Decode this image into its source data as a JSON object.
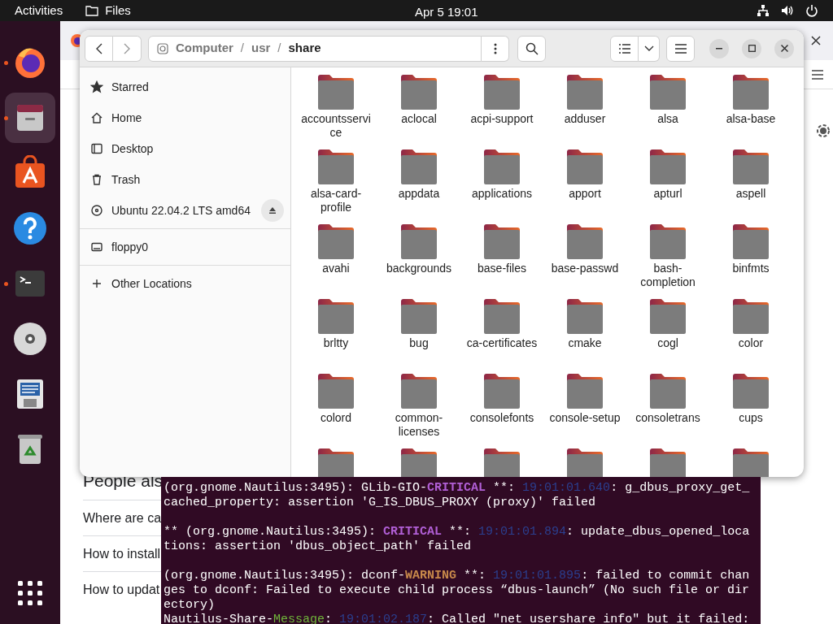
{
  "top_bar": {
    "activities": "Activities",
    "app_menu": "Files",
    "clock": "Apr 5  19:01"
  },
  "dock": [
    {
      "kind": "firefox",
      "running": true,
      "selected": false
    },
    {
      "kind": "files",
      "running": true,
      "selected": true
    },
    {
      "kind": "appcenter",
      "running": false,
      "selected": false
    },
    {
      "kind": "help",
      "running": false,
      "selected": false
    },
    {
      "kind": "terminal",
      "running": true,
      "selected": false
    },
    {
      "kind": "disc",
      "running": false,
      "selected": false
    },
    {
      "kind": "floppy",
      "running": false,
      "selected": false
    },
    {
      "kind": "trash",
      "running": false,
      "selected": false
    }
  ],
  "browser": {
    "heading": "People als",
    "links": [
      "Where are ca",
      "How to install",
      "How to updat"
    ]
  },
  "files_window": {
    "path": [
      {
        "kind": "segment",
        "text": "Computer",
        "selected": false
      },
      {
        "kind": "separator",
        "text": "/"
      },
      {
        "kind": "segment",
        "text": "usr",
        "selected": false
      },
      {
        "kind": "separator",
        "text": "/"
      },
      {
        "kind": "segment",
        "text": "share",
        "selected": true
      }
    ],
    "sidebar": [
      {
        "kind": "starred",
        "label": "Starred"
      },
      {
        "kind": "home",
        "label": "Home"
      },
      {
        "kind": "desktop",
        "label": "Desktop"
      },
      {
        "kind": "trash",
        "label": "Trash"
      },
      {
        "kind": "drive",
        "label": "Ubuntu 22.04.2 LTS amd64",
        "ejectable": true
      },
      {
        "kind": "floppy",
        "label": "floppy0",
        "ejectable": false
      },
      {
        "kind": "other",
        "label": "Other Locations"
      }
    ],
    "folders": [
      {
        "kind": "folder",
        "name": "accountsservice"
      },
      {
        "kind": "folder",
        "name": "aclocal"
      },
      {
        "kind": "folder",
        "name": "acpi-support"
      },
      {
        "kind": "folder",
        "name": "adduser"
      },
      {
        "kind": "folder",
        "name": "alsa"
      },
      {
        "kind": "folder",
        "name": "alsa-base"
      },
      {
        "kind": "folder",
        "name": "alsa-card-profile"
      },
      {
        "kind": "folder",
        "name": "appdata"
      },
      {
        "kind": "folder",
        "name": "applications"
      },
      {
        "kind": "folder",
        "name": "apport"
      },
      {
        "kind": "folder",
        "name": "apturl"
      },
      {
        "kind": "folder",
        "name": "aspell"
      },
      {
        "kind": "folder",
        "name": "avahi"
      },
      {
        "kind": "folder",
        "name": "backgrounds"
      },
      {
        "kind": "folder",
        "name": "base-files"
      },
      {
        "kind": "folder",
        "name": "base-passwd"
      },
      {
        "kind": "folder",
        "name": "bash-completion"
      },
      {
        "kind": "folder",
        "name": "binfmts"
      },
      {
        "kind": "folder",
        "name": "brltty"
      },
      {
        "kind": "folder",
        "name": "bug"
      },
      {
        "kind": "folder",
        "name": "ca-certificates"
      },
      {
        "kind": "folder",
        "name": "cmake"
      },
      {
        "kind": "folder",
        "name": "cogl"
      },
      {
        "kind": "folder",
        "name": "color"
      },
      {
        "kind": "folder",
        "name": "colord"
      },
      {
        "kind": "folder",
        "name": "common-licenses"
      },
      {
        "kind": "folder",
        "name": "consolefonts"
      },
      {
        "kind": "folder",
        "name": "console-setup"
      },
      {
        "kind": "folder",
        "name": "consoletrans"
      },
      {
        "kind": "folder",
        "name": "cups"
      },
      {
        "kind": "folder"
      },
      {
        "kind": "folder"
      },
      {
        "kind": "folder"
      },
      {
        "kind": "folder"
      },
      {
        "kind": "folder"
      },
      {
        "kind": "folder"
      }
    ]
  },
  "terminal": {
    "messages": [
      [
        {
          "kind": "plain",
          "text": "(org.gnome.Nautilus:3495): GLib-GIO-"
        },
        {
          "kind": "critical",
          "text": "CRITICAL"
        },
        {
          "kind": "plain",
          "text": " **: "
        },
        {
          "kind": "timestamp",
          "text": "19:01:01.640"
        },
        {
          "kind": "plain",
          "text": ": g_dbus_proxy_get_cached_property: assertion 'G_IS_DBUS_PROXY (proxy)' failed"
        }
      ],
      [
        {
          "kind": "plain",
          "text": "** (org.gnome.Nautilus:3495): "
        },
        {
          "kind": "critical",
          "text": "CRITICAL"
        },
        {
          "kind": "plain",
          "text": " **: "
        },
        {
          "kind": "timestamp",
          "text": "19:01:01.894"
        },
        {
          "kind": "plain",
          "text": ": update_dbus_opened_locations: assertion 'dbus_object_path' failed"
        }
      ],
      [
        {
          "kind": "plain",
          "text": "(org.gnome.Nautilus:3495): dconf-"
        },
        {
          "kind": "warning",
          "text": "WARNING"
        },
        {
          "kind": "plain",
          "text": " **: "
        },
        {
          "kind": "timestamp",
          "text": "19:01:01.895"
        },
        {
          "kind": "plain",
          "text": ": failed to commit changes to dconf: Failed to execute child process “dbus-launch” (No such file or directory)"
        }
      ],
      [
        {
          "kind": "plain",
          "text": "Nautilus-Share-"
        },
        {
          "kind": "message",
          "text": "Message"
        },
        {
          "kind": "plain",
          "text": ": "
        },
        {
          "kind": "timestamp",
          "text": "19:01:02.187"
        },
        {
          "kind": "plain",
          "text": ": Called \"net usershare info\" but it failed:"
        }
      ]
    ]
  }
}
